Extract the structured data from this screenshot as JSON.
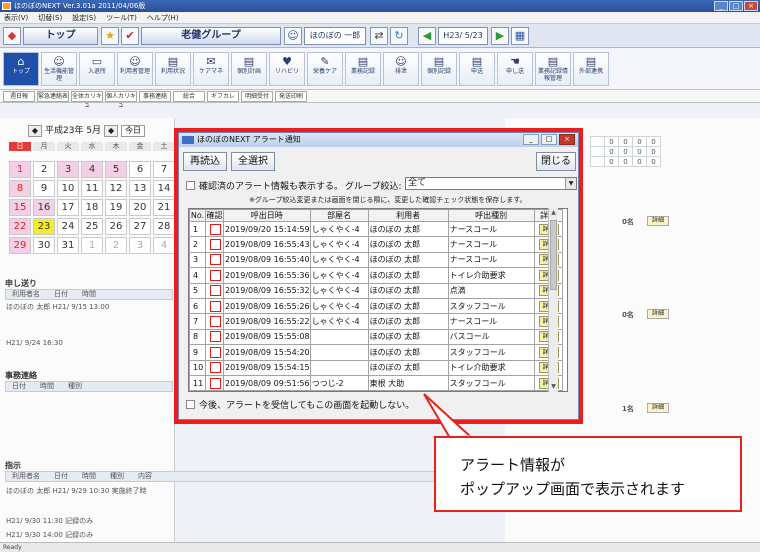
{
  "window": {
    "title": "ほのぼのNEXT  Ver.3.01a    2011/04/06版"
  },
  "menu": [
    "表示(V)",
    "切替(S)",
    "設定(S)",
    "ツール(T)",
    "ヘルプ(H)"
  ],
  "nav": {
    "top_label": "トップ",
    "group_label": "老健グループ",
    "user_label": "ほのぼの 一郎",
    "date_label": "H23/ 5/23"
  },
  "toolbar": [
    {
      "icon": "home-icon",
      "label": "トップ",
      "active": true
    },
    {
      "icon": "person-icon",
      "label": "生活機能管理"
    },
    {
      "icon": "bed-icon",
      "label": "入退所"
    },
    {
      "icon": "person-icon",
      "label": "利用者管理"
    },
    {
      "icon": "doc-icon",
      "label": "利用状況"
    },
    {
      "icon": "chat-icon",
      "label": "ケアマネ"
    },
    {
      "icon": "doc-icon",
      "label": "個別計画"
    },
    {
      "icon": "heart-icon",
      "label": "リハビリ"
    },
    {
      "icon": "pen-icon",
      "label": "栄養ケア"
    },
    {
      "icon": "doc-icon",
      "label": "業務記録"
    },
    {
      "icon": "person-icon",
      "label": "排泄"
    },
    {
      "icon": "doc-icon",
      "label": "個別記録"
    },
    {
      "icon": "doc-icon",
      "label": "申送"
    },
    {
      "icon": "hand-icon",
      "label": "申し送"
    },
    {
      "icon": "doc-icon",
      "label": "業務記録情報管理"
    },
    {
      "icon": "doc-icon",
      "label": "外部連携"
    }
  ],
  "subtabs": [
    "週日報",
    "緊急連絡表",
    "全体カリキュ",
    "個人カリキュ",
    "事務連絡",
    "総合",
    "ギフカレ",
    "明細受付",
    "発送印刷"
  ],
  "calendar": {
    "header": "平成23年 5月",
    "today_label": "今日",
    "weekdays": [
      "日",
      "月",
      "火",
      "水",
      "木",
      "金",
      "土"
    ],
    "days": [
      "1",
      "2",
      "3",
      "4",
      "5",
      "6",
      "7",
      "8",
      "9",
      "10",
      "11",
      "12",
      "13",
      "14",
      "15",
      "16",
      "17",
      "18",
      "19",
      "20",
      "21",
      "22",
      "23",
      "24",
      "25",
      "26",
      "27",
      "28",
      "29",
      "30",
      "31",
      "1",
      "2",
      "3",
      "4"
    ]
  },
  "left": {
    "handover_title": "申し送り",
    "handover_cols": [
      "利用者名",
      "日付",
      "時間"
    ],
    "handover_rows": [
      "ほのぼの 太郎    H21/ 9/15   13:00",
      "                  H21/ 9/24   16:30"
    ],
    "office_title": "事務連絡",
    "office_cols": [
      "日付",
      "時間",
      "種別"
    ],
    "instr_title": "指示",
    "instr_cols": [
      "利用者名",
      "日付",
      "時間",
      "種別",
      "内容"
    ],
    "instr_rows": [
      "ほのぼの 太郎    H21/ 9/29  10:30  実施終了時",
      "                  H21/ 9/30  11:30  記録のみ",
      "                  H21/ 9/30  14:00  記録のみ"
    ]
  },
  "right": {
    "count_a": "0名",
    "count_b": "0名",
    "count_c": "1名",
    "detail_label": "詳細"
  },
  "popup": {
    "title": "ほのぼのNEXT アラート通知",
    "reload_button": "再読込",
    "select_all_button": "全選択",
    "close_button": "閉じる",
    "show_confirmed_label": "確認済のアラート情報も表示する。",
    "group_filter_label": "グループ絞込:",
    "group_filter_value": "全て",
    "note": "※グループ絞込変更または画面を閉じる際に、変更した確認チェック状態を保存します。",
    "columns": [
      "No.",
      "確認",
      "呼出日時",
      "部屋名",
      "利用者",
      "呼出種別",
      "詳細"
    ],
    "detail_label": "詳細",
    "rows": [
      {
        "no": "1",
        "datetime": "2019/09/20 15:14:59",
        "room": "しゃくやく-4",
        "user": "ほのぼの 太郎",
        "type": "ナースコール"
      },
      {
        "no": "2",
        "datetime": "2019/08/09 16:55:43",
        "room": "しゃくやく-4",
        "user": "ほのぼの 太郎",
        "type": "ナースコール"
      },
      {
        "no": "3",
        "datetime": "2019/08/09 16:55:40",
        "room": "しゃくやく-4",
        "user": "ほのぼの 太郎",
        "type": "ナースコール"
      },
      {
        "no": "4",
        "datetime": "2019/08/09 16:55:36",
        "room": "しゃくやく-4",
        "user": "ほのぼの 太郎",
        "type": "トイレ介助要求"
      },
      {
        "no": "5",
        "datetime": "2019/08/09 16:55:32",
        "room": "しゃくやく-4",
        "user": "ほのぼの 太郎",
        "type": "点滴"
      },
      {
        "no": "6",
        "datetime": "2019/08/09 16:55:26",
        "room": "しゃくやく-4",
        "user": "ほのぼの 太郎",
        "type": "スタッフコール"
      },
      {
        "no": "7",
        "datetime": "2019/08/09 16:55:22",
        "room": "しゃくやく-4",
        "user": "ほのぼの 太郎",
        "type": "ナースコール"
      },
      {
        "no": "8",
        "datetime": "2019/08/09 15:55:08",
        "room": "",
        "user": "ほのぼの 太郎",
        "type": "バスコール"
      },
      {
        "no": "9",
        "datetime": "2019/08/09 15:54:20",
        "room": "",
        "user": "ほのぼの 太郎",
        "type": "スタッフコール"
      },
      {
        "no": "10",
        "datetime": "2019/08/09 15:54:15",
        "room": "",
        "user": "ほのぼの 太郎",
        "type": "トイレ介助要求"
      },
      {
        "no": "11",
        "datetime": "2019/08/09 09:51:56",
        "room": "つつじ-2",
        "user": "東根 大助",
        "type": "スタッフコール"
      }
    ],
    "startup_label": "今後、アラートを受信してもこの画面を起動しない。"
  },
  "callout": {
    "line1": "アラート情報が",
    "line2": "ポップアップ画面で表示されます"
  },
  "status": "Ready"
}
